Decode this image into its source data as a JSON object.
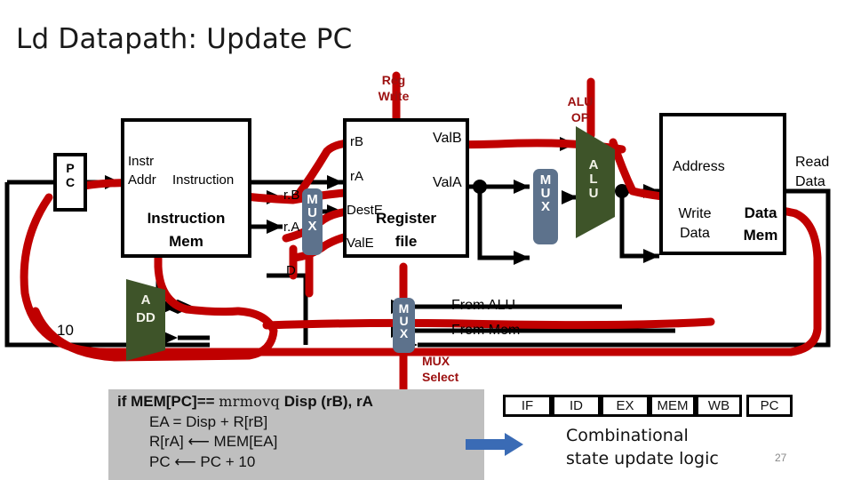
{
  "slide": {
    "title": "Ld Datapath: Update PC",
    "page_number": "27",
    "colors": {
      "highlight_path": "#c00000",
      "control_label": "#9c1010",
      "mux_fill": "#5d728c",
      "alu_fill": "#3e5429",
      "code_bg": "#bfbfbf",
      "arrow_blue": "#3a6bb5"
    }
  },
  "control_labels": {
    "reg_write": "Reg\nWrite",
    "reg_write_l1": "Reg",
    "reg_write_l2": "Write",
    "alu_op_l1": "ALU",
    "alu_op_l2": "OP",
    "mux_select_l1": "MUX",
    "mux_select_l2": "Select"
  },
  "pc": {
    "label_l1": "P",
    "label_l2": "C"
  },
  "instruction_mem": {
    "port_instr": "Instr",
    "port_addr": "Addr",
    "port_instruction": "Instruction",
    "name_l1": "Instruction",
    "name_l2": "Mem"
  },
  "reg_mux": {
    "glyph_m": "M",
    "glyph_u": "U",
    "glyph_x": "X",
    "in_rb": "r.B",
    "in_ra": "r.A",
    "sel_d": "D"
  },
  "register_file": {
    "in_rb": "rB",
    "in_ra": "rA",
    "in_deste": "DestE",
    "in_vale": "ValE",
    "out_valb": "ValB",
    "out_vala": "ValA",
    "name_l1": "Register",
    "name_l2": "file"
  },
  "alu_mux": {
    "glyph_m": "M",
    "glyph_u": "U",
    "glyph_x": "X"
  },
  "alu": {
    "label_l1": "A",
    "label_l2": "L",
    "label_l3": "U"
  },
  "add_unit": {
    "label_l1": "A",
    "label_l2": "DD",
    "constant_input": "10"
  },
  "data_mem": {
    "port_address": "Address",
    "port_write_data_l1": "Write",
    "port_write_data_l2": "Data",
    "port_read_data_l1": "Read",
    "port_read_data_l2": "Data",
    "name_l1": "Data",
    "name_l2": "Mem"
  },
  "wb_mux": {
    "glyph_m": "M",
    "glyph_u": "U",
    "glyph_x": "X",
    "in_from_alu": "From ALU",
    "in_from_mem": "From Mem"
  },
  "code": {
    "line1_a": "if MEM[PC]== ",
    "line1_mnemonic": "mrmovq",
    "line1_b": " Disp (rB), rA",
    "line2": "EA = Disp + R[rB]",
    "line3": "R[rA] ⟵ MEM[EA]",
    "line4": "PC ⟵ PC + 10"
  },
  "stages": {
    "items": [
      {
        "label": "IF"
      },
      {
        "label": "ID"
      },
      {
        "label": "EX"
      },
      {
        "label": "MEM"
      },
      {
        "label": "WB"
      },
      {
        "label": "PC"
      }
    ]
  },
  "footer": {
    "caption_l1": "Combinational",
    "caption_l2": "state update logic"
  }
}
